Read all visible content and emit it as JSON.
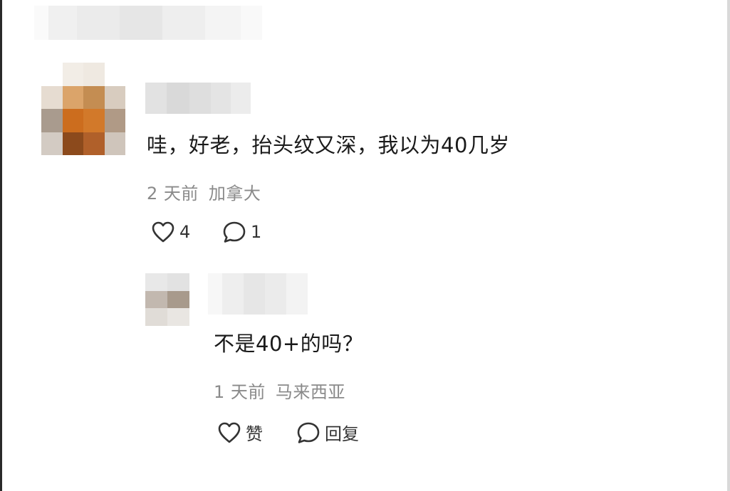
{
  "comment": {
    "text": "哇，好老，抬头纹又深，我以为40几岁",
    "time": "2 天前",
    "location": "加拿大",
    "likes": "4",
    "replies": "1"
  },
  "reply": {
    "text": "不是40+的吗？",
    "time": "1 天前",
    "location": "马来西亚",
    "like_label": "赞",
    "reply_label": "回复"
  },
  "colors": {
    "meta_text": "#8a8a8a",
    "primary_text": "#1a1a1a",
    "icon_stroke": "#333333"
  },
  "icons": [
    "heart-icon",
    "comment-bubble-icon"
  ]
}
